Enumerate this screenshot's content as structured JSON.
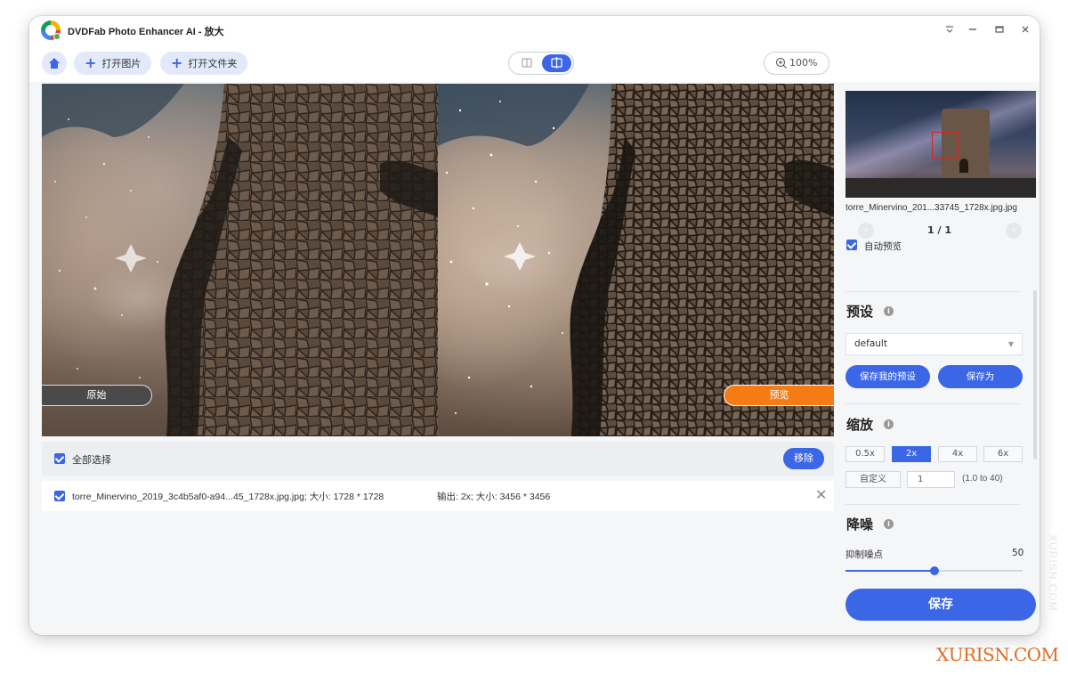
{
  "window": {
    "title": "DVDFab Photo Enhancer AI - 放大",
    "controls": [
      "pin-icon",
      "minimize-icon",
      "maximize-icon",
      "close-icon"
    ]
  },
  "toolbar": {
    "open_image_label": "打开图片",
    "open_folder_label": "打开文件夹",
    "zoom_label": "100%"
  },
  "preview": {
    "original_label": "原始",
    "preview_label": "预览"
  },
  "file_list": {
    "select_all_label": "全部选择",
    "remove_label": "移除",
    "rows": [
      {
        "name": "torre_Minervino_2019_3c4b5af0-a94...45_1728x.jpg.jpg; 大小: 1728 * 1728",
        "output": "输出: 2x; 大小: 3456 * 3456",
        "checked": true
      }
    ]
  },
  "sidebar": {
    "thumbnail_name": "torre_Minervino_201...33745_1728x.jpg.jpg",
    "page": "1 / 1",
    "auto_preview_label": "自动预览",
    "preset": {
      "title": "预设",
      "selected": "default",
      "save_my_preset_label": "保存我的预设",
      "save_as_label": "保存为"
    },
    "scale": {
      "title": "缩放",
      "options": [
        "0.5x",
        "2x",
        "4x",
        "6x"
      ],
      "selected": "2x",
      "custom_label": "自定义",
      "custom_value": "1",
      "custom_range": "(1.0 to 40)"
    },
    "denoise": {
      "title": "降噪",
      "slider_label": "抑制噪点",
      "slider_value": "50",
      "slider_fraction": 0.5
    },
    "save_label": "保存"
  },
  "watermarks": {
    "corner": "XURISN.COM",
    "side": "XURISN.COM"
  },
  "colors": {
    "accent": "#3b66e6",
    "preview_tag": "#f57c14",
    "original_tag": "#4a4a4a"
  }
}
